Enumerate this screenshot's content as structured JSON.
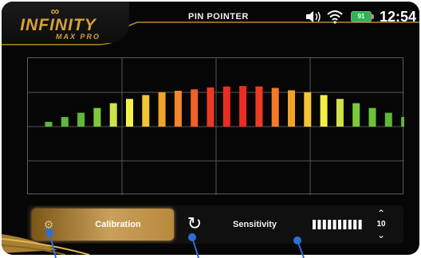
{
  "header": {
    "logo_symbol": "∞",
    "logo_title": "INFINITY",
    "logo_subtitle": "MAX PRO",
    "mode_title": "PIN POINTER",
    "battery_level": "91",
    "clock": "12:54"
  },
  "status_icons": [
    "volume-icon",
    "wifi-icon",
    "battery-icon"
  ],
  "chart_data": {
    "type": "bar",
    "values": [
      0.1,
      0.2,
      0.29,
      0.39,
      0.49,
      0.58,
      0.66,
      0.72,
      0.75,
      0.78,
      0.82,
      0.84,
      0.85,
      0.84,
      0.81,
      0.76,
      0.72,
      0.66,
      0.58,
      0.49,
      0.39,
      0.29,
      0.2,
      0.1,
      0.04
    ],
    "colors": [
      "#5fb838",
      "#5fb838",
      "#5fb838",
      "#7cc93a",
      "#cfe24a",
      "#f4f04a",
      "#f0c436",
      "#f0a329",
      "#f3852a",
      "#f06028",
      "#ea3a24",
      "#ec2b23",
      "#ec2b23",
      "#ee3a24",
      "#f47a2a",
      "#f3a229",
      "#f3c636",
      "#f4ee49",
      "#cfe24a",
      "#7cc93a",
      "#6cc03a",
      "#5fb838",
      "#5fb838",
      "#5fb838",
      "#5fb838"
    ],
    "grid": true,
    "grid_columns": 4,
    "grid_rows": 4,
    "ylim": [
      0,
      1
    ]
  },
  "controls": {
    "calibration_label": "Calibration",
    "calibration_icon": "gear-icon",
    "refresh_icon": "refresh-icon",
    "sensitivity_label": "Sensitivity",
    "sensitivity_level": 10,
    "sensitivity_segments": 10,
    "stepper_up": "⌃",
    "stepper_down": "⌄"
  },
  "colors": {
    "accent_gold": "#d6a138",
    "battery_green": "#31b34d",
    "callout_blue": "#2f6fd4"
  }
}
